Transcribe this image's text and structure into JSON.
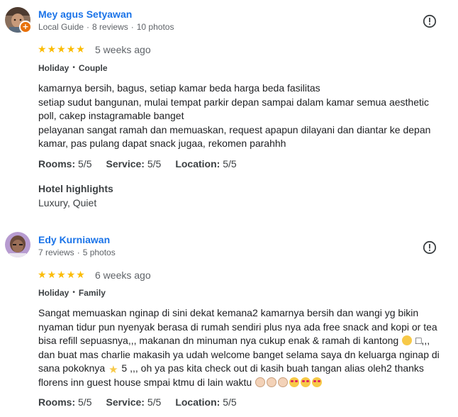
{
  "reviews": [
    {
      "name": "Mey agus Setyawan",
      "badge": "+",
      "meta": [
        "Local Guide",
        "8 reviews",
        "10 photos"
      ],
      "stars": [
        "★",
        "★",
        "★",
        "★",
        "★"
      ],
      "time": "5 weeks ago",
      "tags": [
        "Holiday",
        "Couple"
      ],
      "text": [
        "kamarnya bersih, bagus, setiap kamar beda harga beda fasilitas",
        "setiap sudut bangunan, mulai tempat parkir depan sampai dalam kamar semua aesthetic poll, cakep instagramable banget",
        "pelayanan sangat ramah dan memuaskan, request apapun dilayani dan diantar ke depan kamar, pas pulang dapat snack jugaa, rekomen parahhh"
      ],
      "ratings": [
        {
          "label": "Rooms:",
          "value": "5/5"
        },
        {
          "label": "Service:",
          "value": "5/5"
        },
        {
          "label": "Location:",
          "value": "5/5"
        }
      ],
      "highlights_title": "Hotel highlights",
      "highlights": "Luxury, Quiet"
    },
    {
      "name": "Edy Kurniawan",
      "meta": [
        "7 reviews",
        "5 photos"
      ],
      "stars": [
        "★",
        "★",
        "★",
        "★",
        "★"
      ],
      "time": "6 weeks ago",
      "tags": [
        "Holiday",
        "Family"
      ],
      "text_parts": {
        "a": "Sangat memuaskan nginap di sini dekat kemana2 kamarnya bersih dan wangi yg bikin nyaman tidur pun nyenyak berasa di rumah sendiri plus nya ada free snack and kopi or tea bisa refill sepuasnya,,, makanan dn minuman nya cukup enak & ramah di kantong",
        "b": "□,,, dan buat mas charlie makasih ya udah welcome banget selama saya dn keluarga nginap di sana pokoknya",
        "c": "5 ,,, oh ya pas kita check out di kasih buah tangan alias oleh2 thanks florens inn guest house smpai ktmu di lain waktu"
      },
      "ratings": [
        {
          "label": "Rooms:",
          "value": "5/5"
        },
        {
          "label": "Service:",
          "value": "5/5"
        },
        {
          "label": "Location:",
          "value": "5/5"
        }
      ]
    }
  ],
  "icons": {
    "flag": "report-flag-icon",
    "star_color": "#fbbc04",
    "name_color": "#1a73e8"
  }
}
